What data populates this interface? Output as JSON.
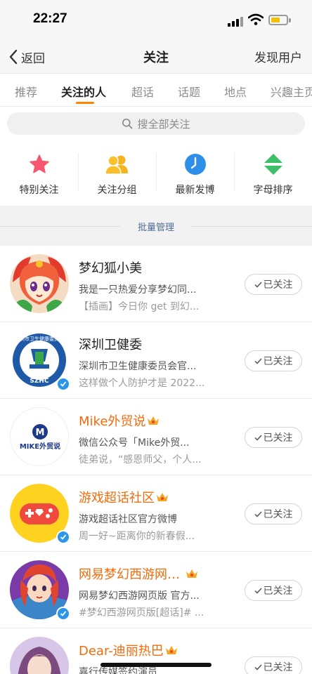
{
  "status_bar": {
    "time": "22:27"
  },
  "nav": {
    "back_label": "返回",
    "title": "关注",
    "discover_label": "发现用户"
  },
  "tabs": [
    {
      "label": "推荐",
      "active": false
    },
    {
      "label": "关注的人",
      "active": true
    },
    {
      "label": "超话",
      "active": false
    },
    {
      "label": "话题",
      "active": false
    },
    {
      "label": "地点",
      "active": false
    },
    {
      "label": "兴趣主页",
      "active": false
    }
  ],
  "search": {
    "placeholder": "搜全部关注"
  },
  "quick_actions": [
    {
      "label": "特别关注",
      "icon": "star-icon"
    },
    {
      "label": "关注分组",
      "icon": "group-icon"
    },
    {
      "label": "最新发博",
      "icon": "clock-icon"
    },
    {
      "label": "字母排序",
      "icon": "sort-icon"
    }
  ],
  "batch": {
    "label": "批量管理"
  },
  "follow_button_label": "已关注",
  "items": [
    {
      "name": "梦幻狐小美",
      "vip": false,
      "verified": false,
      "desc": "我是一只热爱分享梦幻同...",
      "post": "【插画】今日你 get 到幻..."
    },
    {
      "name": "深圳卫健委",
      "vip": false,
      "verified": true,
      "desc": "深圳市卫生健康委员会官...",
      "post": "这样做个人防护才是 2022..."
    },
    {
      "name": "Mike外贸说",
      "vip": true,
      "verified": false,
      "desc": "微信公众号「Mike外贸...",
      "post": "徒弟说，“感恩师父，个人..."
    },
    {
      "name": "游戏超话社区",
      "vip": true,
      "verified": true,
      "desc": "游戏超话社区官方微博",
      "post": "周一好~距离你的新春假..."
    },
    {
      "name": "网易梦幻西游网…",
      "vip": true,
      "verified": true,
      "desc": "网易梦幻西游网页版 官方...",
      "post": "#梦幻西游网页版[超话]# ..."
    },
    {
      "name": "Dear-迪丽热巴",
      "vip": true,
      "verified": false,
      "desc": "嘉行传媒签约演员",
      "post": ""
    }
  ],
  "avatar_texts": {
    "szhc_logo": "深圳市卫生健康委员会",
    "szhc_letters": "SZHC",
    "mike_logo": "MIKE外贸说"
  },
  "colors": {
    "accent": "#ff8200",
    "vip_name": "#f26b0b",
    "verified": "#2a96ea"
  }
}
